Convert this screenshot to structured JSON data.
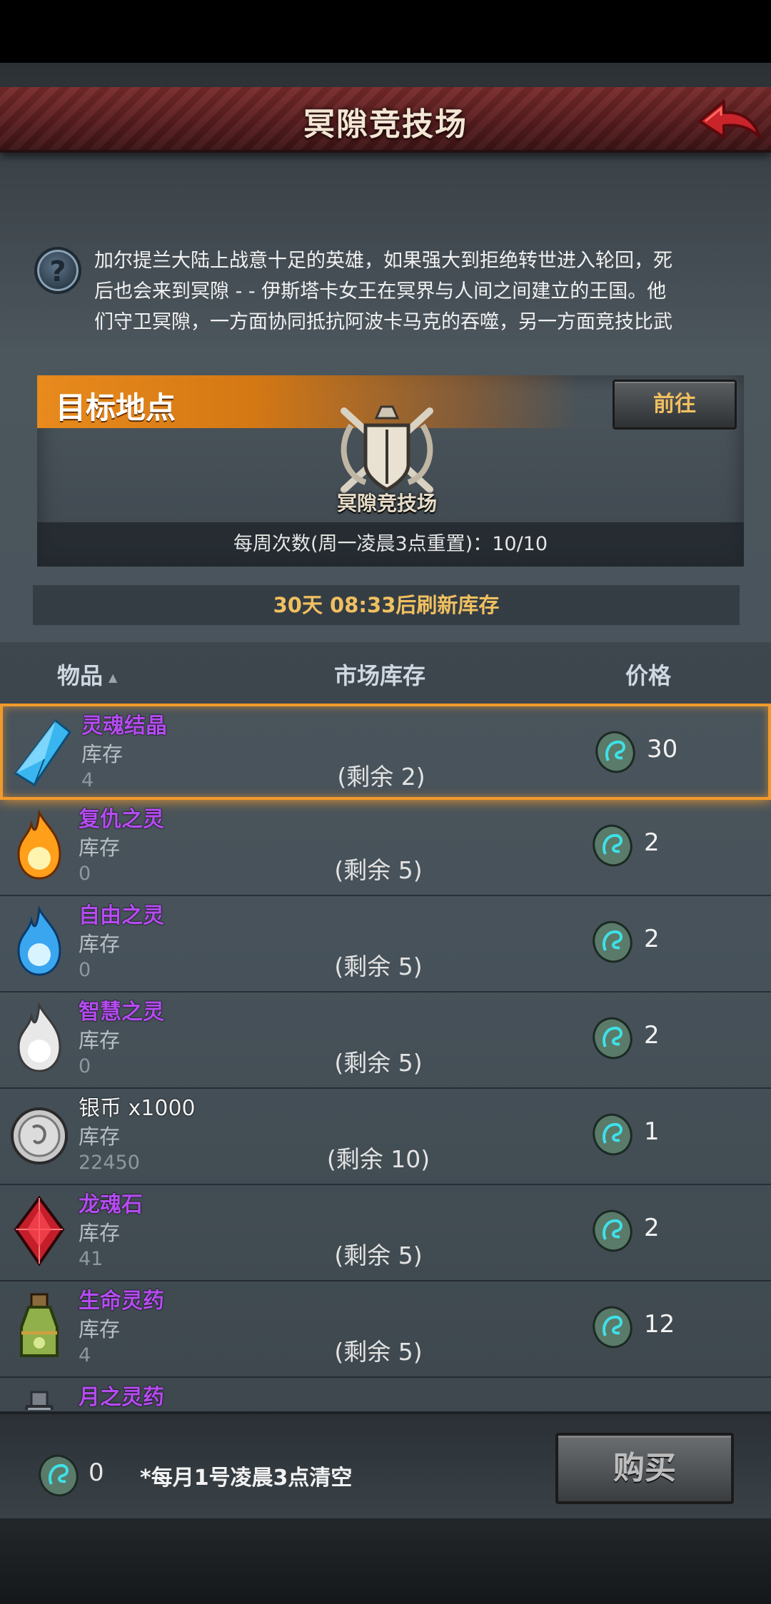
{
  "header": {
    "title": "冥隙竞技场",
    "back_icon": "red-back-arrow-icon"
  },
  "description": {
    "help_icon": "?",
    "lines": [
      "加尔提兰大陆上战意十足的英雄，如果强大到拒绝转世进入轮回，死",
      "后也会来到冥隙 - - 伊斯塔卡女王在冥界与人间之间建立的王国。他",
      "们守卫冥隙，一方面协同抵抗阿波卡马克的吞噬，另一方面竞技比武"
    ]
  },
  "target": {
    "label": "目标地点",
    "goto_label": "前往",
    "location_name": "冥隙竞技场",
    "weekly_text": "每周次数(周一凌晨3点重置)：10/10"
  },
  "refresh_text": "30天 08:33后刷新库存",
  "table": {
    "col_item": "物品",
    "col_stock": "市场库存",
    "col_price": "价格",
    "sort_indicator": "▲"
  },
  "items": [
    {
      "name": "灵魂结晶",
      "suffix": "",
      "stock_label": "库存",
      "stock": "4",
      "remain": "(剩余 2)",
      "price": "30",
      "icon": "blue-crystal-icon",
      "selected": true
    },
    {
      "name": "复仇之灵",
      "suffix": "",
      "stock_label": "库存",
      "stock": "0",
      "remain": "(剩余 5)",
      "price": "2",
      "icon": "fire-spirit-icon"
    },
    {
      "name": "自由之灵",
      "suffix": "",
      "stock_label": "库存",
      "stock": "0",
      "remain": "(剩余 5)",
      "price": "2",
      "icon": "blue-spirit-icon"
    },
    {
      "name": "智慧之灵",
      "suffix": "",
      "stock_label": "库存",
      "stock": "0",
      "remain": "(剩余 5)",
      "price": "2",
      "icon": "white-spirit-icon"
    },
    {
      "name": "银币",
      "suffix": " x1000",
      "stock_label": "库存",
      "stock": "22450",
      "remain": "(剩余 10)",
      "price": "1",
      "icon": "silver-coin-icon",
      "white": true
    },
    {
      "name": "龙魂石",
      "suffix": "",
      "stock_label": "库存",
      "stock": "41",
      "remain": "(剩余 5)",
      "price": "2",
      "icon": "red-gem-icon"
    },
    {
      "name": "生命灵药",
      "suffix": "",
      "stock_label": "库存",
      "stock": "4",
      "remain": "(剩余 5)",
      "price": "12",
      "icon": "green-potion-icon"
    },
    {
      "name": "月之灵药",
      "suffix": "",
      "stock_label": "",
      "stock": "",
      "remain": "",
      "price": "",
      "icon": "moon-potion-icon"
    }
  ],
  "footer": {
    "currency_count": "0",
    "note": "*每月1号凌晨3点清空",
    "buy_label": "购买"
  },
  "colors": {
    "accent_orange": "#f19a2c",
    "item_name_purple": "#b44cf0",
    "gold_text": "#f0c060",
    "title_bar_red": "#7a2b2b"
  }
}
